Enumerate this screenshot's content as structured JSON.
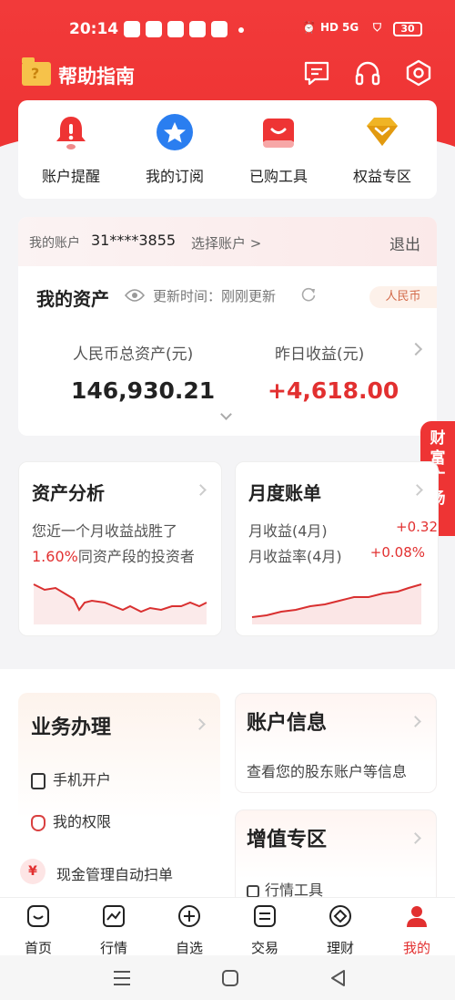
{
  "status_bar": {
    "time": "20:14",
    "network": "5G",
    "battery": "30"
  },
  "header": {
    "title": "帮助指南"
  },
  "quick_actions": [
    {
      "label": "账户提醒",
      "icon": "bell-icon"
    },
    {
      "label": "我的订阅",
      "icon": "star-icon"
    },
    {
      "label": "已购工具",
      "icon": "bag-icon"
    },
    {
      "label": "权益专区",
      "icon": "diamond-icon"
    }
  ],
  "account": {
    "label": "我的账户",
    "number": "31****3855",
    "select": "选择账户 >",
    "logout": "退出"
  },
  "assets": {
    "title": "我的资产",
    "update_text": "更新时间：刚刚更新",
    "currency_tag": "人民币",
    "total_label": "人民币总资产(元)",
    "total_value": "146,930.21",
    "yesterday_label": "昨日收益(元)",
    "yesterday_value": "+4,618.00"
  },
  "side_tab": {
    "label": "财富广场"
  },
  "analysis": {
    "title": "资产分析",
    "line1": "您近一个月收益战胜了",
    "line2_pct": "1.60%",
    "line2_rest": "同资产段的投资者"
  },
  "monthly": {
    "title": "月度账单",
    "row1_label": "月收益(4月)",
    "row1_value": "+0.32",
    "row2_label": "月收益率(4月)",
    "row2_value": "+0.08%"
  },
  "business": {
    "title": "业务办理",
    "items": [
      "手机开户",
      "我的权限"
    ],
    "pill": "现金管理自动扫单",
    "pill_icon_text": "¥"
  },
  "account_info": {
    "title": "账户信息",
    "desc": "查看您的股东账户等信息"
  },
  "value_added": {
    "title": "增值专区",
    "sub": "行情工具"
  },
  "bottom_nav": [
    {
      "label": "首页",
      "icon": "home-icon"
    },
    {
      "label": "行情",
      "icon": "chart-icon"
    },
    {
      "label": "自选",
      "icon": "plus-circle-icon"
    },
    {
      "label": "交易",
      "icon": "trade-icon"
    },
    {
      "label": "理财",
      "icon": "wealth-icon"
    },
    {
      "label": "我的",
      "icon": "user-icon"
    }
  ],
  "colors": {
    "brand_red": "#ee3434",
    "profit_red": "#e23030"
  }
}
